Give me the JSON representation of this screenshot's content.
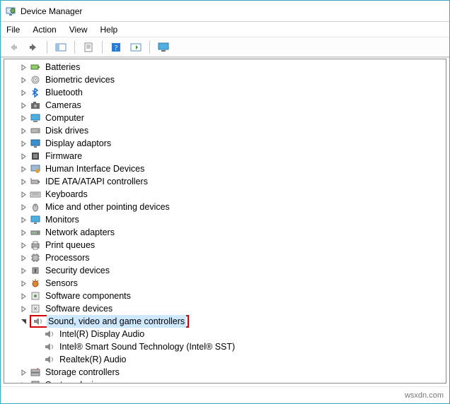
{
  "window": {
    "title": "Device Manager"
  },
  "menu": {
    "file": "File",
    "action": "Action",
    "view": "View",
    "help": "Help"
  },
  "footer": {
    "watermark": "wsxdn.com"
  },
  "tree": {
    "categories": [
      {
        "label": "Batteries",
        "icon": "battery"
      },
      {
        "label": "Biometric devices",
        "icon": "fingerprint"
      },
      {
        "label": "Bluetooth",
        "icon": "bluetooth"
      },
      {
        "label": "Cameras",
        "icon": "camera"
      },
      {
        "label": "Computer",
        "icon": "computer"
      },
      {
        "label": "Disk drives",
        "icon": "disk"
      },
      {
        "label": "Display adaptors",
        "icon": "display"
      },
      {
        "label": "Firmware",
        "icon": "firmware"
      },
      {
        "label": "Human Interface Devices",
        "icon": "hid"
      },
      {
        "label": "IDE ATA/ATAPI controllers",
        "icon": "ide"
      },
      {
        "label": "Keyboards",
        "icon": "keyboard"
      },
      {
        "label": "Mice and other pointing devices",
        "icon": "mouse"
      },
      {
        "label": "Monitors",
        "icon": "monitor"
      },
      {
        "label": "Network adapters",
        "icon": "network"
      },
      {
        "label": "Print queues",
        "icon": "printer"
      },
      {
        "label": "Processors",
        "icon": "cpu"
      },
      {
        "label": "Security devices",
        "icon": "security"
      },
      {
        "label": "Sensors",
        "icon": "sensor"
      },
      {
        "label": "Software components",
        "icon": "swcomp"
      },
      {
        "label": "Software devices",
        "icon": "swdev"
      },
      {
        "label": "Sound, video and game controllers",
        "icon": "sound",
        "expanded": true,
        "selected": true,
        "highlight": true,
        "children": [
          {
            "label": "Intel(R) Display Audio",
            "icon": "sound"
          },
          {
            "label": "Intel® Smart Sound Technology (Intel® SST)",
            "icon": "sound"
          },
          {
            "label": "Realtek(R) Audio",
            "icon": "sound"
          }
        ]
      },
      {
        "label": "Storage controllers",
        "icon": "storage"
      },
      {
        "label": "System devices",
        "icon": "system",
        "clipped": true
      }
    ]
  }
}
